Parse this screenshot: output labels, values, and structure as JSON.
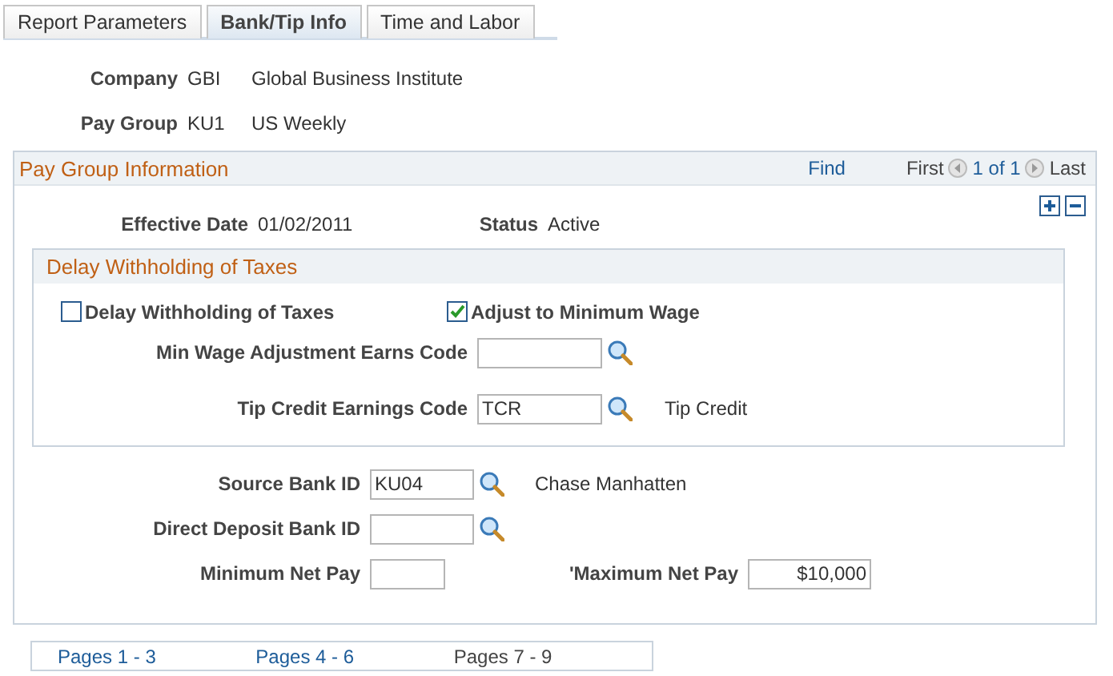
{
  "tabs": [
    {
      "label": "Report Parameters",
      "selected": false
    },
    {
      "label": "Bank/Tip Info",
      "selected": true
    },
    {
      "label": "Time and Labor",
      "selected": false
    }
  ],
  "header": [
    {
      "label": "Company",
      "code": "GBI",
      "description": "Global Business Institute"
    },
    {
      "label": "Pay Group",
      "code": "KU1",
      "description": "US Weekly"
    }
  ],
  "pay_group_info": {
    "title": "Pay Group Information",
    "find": "Find",
    "first": "First",
    "count": "1 of 1",
    "last": "Last",
    "effective_date": {
      "label": "Effective Date",
      "value": "01/02/2011"
    },
    "status": {
      "label": "Status",
      "value": "Active"
    },
    "delay_section": {
      "title": "Delay Withholding of Taxes",
      "checkboxes": [
        {
          "label": "Delay Withholding of Taxes",
          "checked": false
        },
        {
          "label": "Adjust to Minimum Wage",
          "checked": true
        }
      ],
      "fields": [
        {
          "label": "Min Wage Adjustment Earns Code"
        },
        {
          "label": "Tip Credit Earnings Code",
          "value": "TCR",
          "description": "Tip Credit"
        }
      ]
    },
    "bank_fields": [
      {
        "label": "Source Bank ID",
        "value": "KU04",
        "description": "Chase Manhatten"
      },
      {
        "label": "Direct Deposit Bank ID"
      }
    ],
    "net_pay": [
      {
        "label": "Minimum Net Pay"
      },
      {
        "label": "'Maximum Net Pay",
        "value": "$10,000"
      }
    ]
  },
  "page_links": [
    {
      "label": "Pages 1 - 3",
      "selected": false
    },
    {
      "label": "Pages 4 - 6",
      "selected": false
    },
    {
      "label": "Pages 7 - 9",
      "selected": true
    }
  ]
}
